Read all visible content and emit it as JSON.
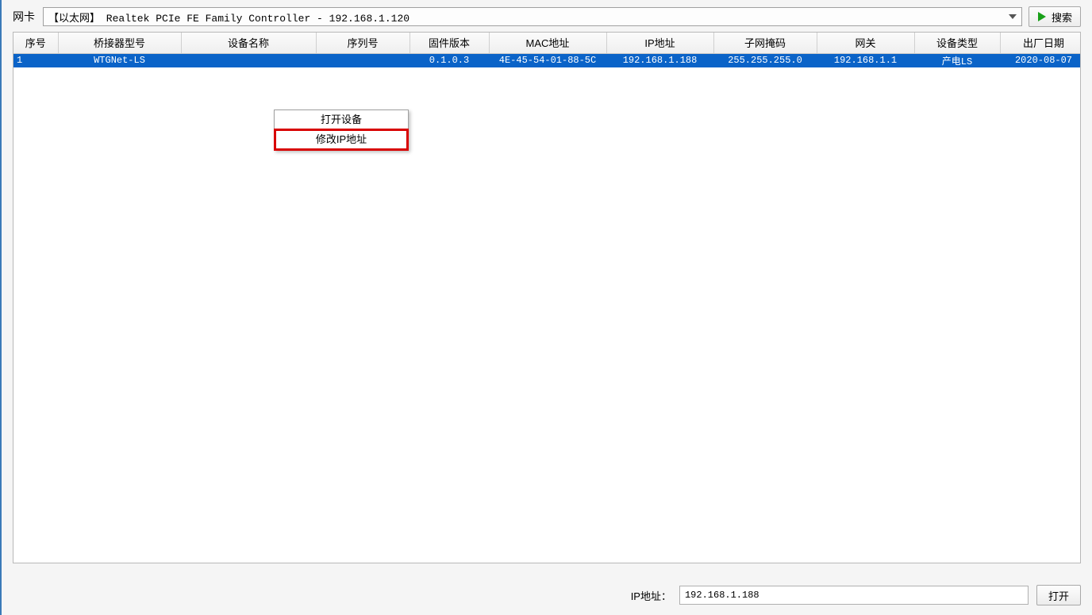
{
  "toolbar": {
    "nic_label": "网卡",
    "nic_value": "【以太网】 Realtek PCIe FE Family Controller - 192.168.1.120",
    "search_label": "搜索"
  },
  "table": {
    "headers": {
      "seq": "序号",
      "model": "桥接器型号",
      "dev_name": "设备名称",
      "serial": "序列号",
      "firmware": "固件版本",
      "mac": "MAC地址",
      "ip": "IP地址",
      "mask": "子网掩码",
      "gateway": "网关",
      "type": "设备类型",
      "mfg_date": "出厂日期"
    },
    "rows": [
      {
        "seq": "1",
        "model": "WTGNet-LS",
        "dev_name": "",
        "serial": "",
        "firmware": "0.1.0.3",
        "mac": "4E-45-54-01-88-5C",
        "ip": "192.168.1.188",
        "mask": "255.255.255.0",
        "gateway": "192.168.1.1",
        "type": "产电LS",
        "mfg_date": "2020-08-07"
      }
    ]
  },
  "context_menu": {
    "open_device": "打开设备",
    "set_ip": "修改IP地址"
  },
  "bottom": {
    "ip_label": "IP地址：",
    "ip_value": "192.168.1.188",
    "open_label": "打开"
  }
}
